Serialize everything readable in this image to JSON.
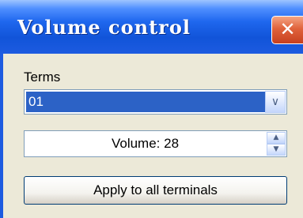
{
  "window": {
    "title": "Volume control",
    "close_symbol": "✕"
  },
  "terms": {
    "label": "Terms",
    "selected": "01",
    "arrow_icon": "chevron-down-icon"
  },
  "volume": {
    "text": "Volume: 28",
    "value": 28,
    "up_icon": "spin-up-icon",
    "down_icon": "spin-down-icon"
  },
  "actions": {
    "apply_label": "Apply to all terminals"
  },
  "colors": {
    "titlebar": "#1f67ee",
    "close": "#e0623b",
    "selection": "#2c62c6",
    "surface": "#ece9d8"
  }
}
